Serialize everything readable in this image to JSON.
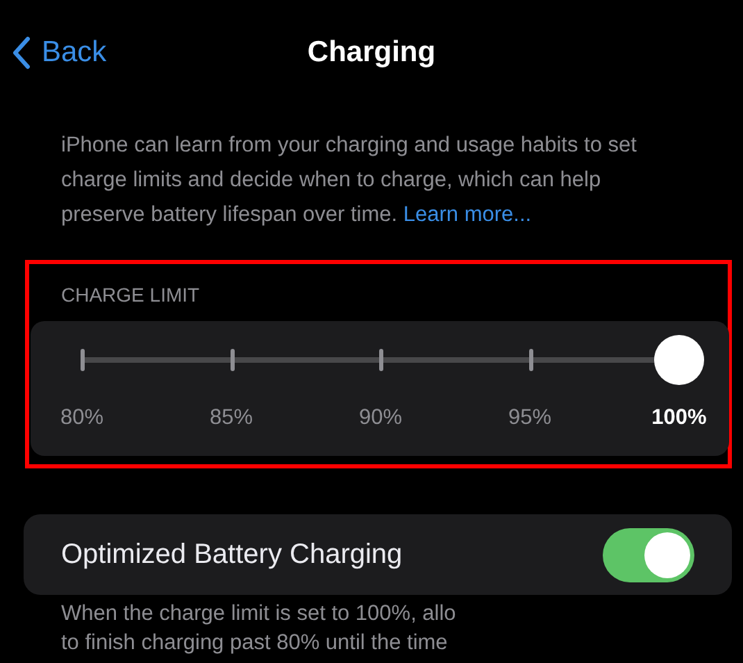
{
  "nav": {
    "back": "Back",
    "title": "Charging"
  },
  "description": {
    "text": "iPhone can learn from your charging and usage habits to set charge limits and decide when to charge, which can help preserve battery lifespan over time.",
    "link": "Learn more..."
  },
  "charge_limit": {
    "header": "CHARGE LIMIT",
    "highlighted": true,
    "level": 1,
    "stops": [
      {
        "label": "80%",
        "selected": false
      },
      {
        "label": "85%",
        "selected": false
      },
      {
        "label": "90%",
        "selected": false
      },
      {
        "label": "95%",
        "selected": false
      },
      {
        "label": "100%",
        "selected": true
      }
    ]
  },
  "optimized": {
    "label": "Optimized Battery Charging",
    "on": true
  },
  "footer_lines": [
    "When the charge limit is set to 100%, allo",
    "to finish charging past 80% until the time"
  ]
}
